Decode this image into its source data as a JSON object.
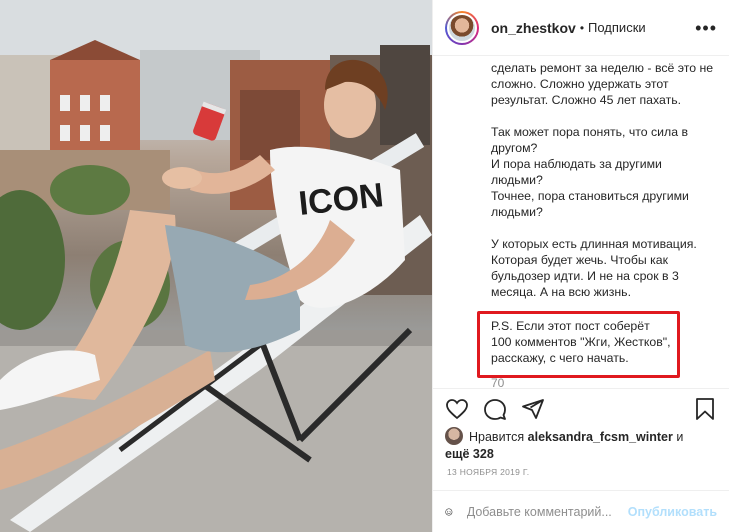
{
  "post": {
    "photo_label": "Мужчина в футболке ICON на шезлонге на крыше"
  },
  "header": {
    "username": "on_zhestkov",
    "separator": "•",
    "follow_label": "Подписки",
    "more_label": "•••"
  },
  "caption": {
    "paragraphs": [
      "сделать ремонт за неделю - всё это не сложно. Сложно удержать этот результат. Сложно 45 лет пахать.",
      "Так может пора понять, что сила в другом?\nИ пора наблюдать за другими людьми?\nТочнее, пора становиться другими людьми?",
      "У которых есть длинная мотивация. Которая будет жечь. Чтобы как бульдозер идти. И не на срок в 3 месяца. А на всю жизнь."
    ],
    "ps": "P.S. Если этот пост соберёт 100 комментов \"Жги, Жестков\", расскажу, с чего начать.",
    "cut_text": "70"
  },
  "likes": {
    "prefix": "Нравится ",
    "user": "aleksandra_fcsm_winter",
    "and": " и",
    "others": "ещё 328"
  },
  "date": "13 НОЯБРЯ 2019 Г.",
  "comment": {
    "placeholder": "Добавьте комментарий...",
    "publish_label": "Опубликовать"
  },
  "photo_shirt_text": "ICON"
}
